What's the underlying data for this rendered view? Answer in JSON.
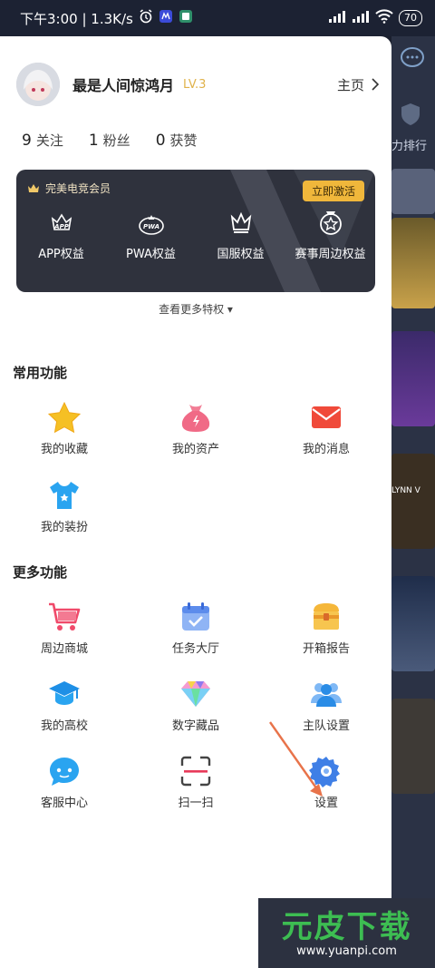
{
  "status_bar": {
    "left_text": "下午3:00 | 1.3K/s",
    "battery": "70"
  },
  "profile": {
    "username": "最是人间惊鸿月",
    "level": "LV.3",
    "homepage_label": "主页"
  },
  "stats": [
    {
      "value": "9",
      "label": "关注"
    },
    {
      "value": "1",
      "label": "粉丝"
    },
    {
      "value": "0",
      "label": "获赞"
    }
  ],
  "vip": {
    "title": "完美电竞会员",
    "activate_label": "立即激活",
    "items": [
      {
        "label": "APP权益",
        "icon": "app-crown-icon"
      },
      {
        "label": "PWA权益",
        "icon": "pwa-crown-icon"
      },
      {
        "label": "国服权益",
        "icon": "crown-icon"
      },
      {
        "label": "赛事周边权益",
        "icon": "medal-icon"
      }
    ]
  },
  "more_privileges": "查看更多特权 ▾",
  "common_functions": {
    "title": "常用功能",
    "items": [
      {
        "label": "我的收藏",
        "icon": "star-icon"
      },
      {
        "label": "我的资产",
        "icon": "money-bag-icon"
      },
      {
        "label": "我的消息",
        "icon": "mail-icon"
      },
      {
        "label": "我的装扮",
        "icon": "tshirt-icon"
      }
    ]
  },
  "more_functions": {
    "title": "更多功能",
    "items": [
      {
        "label": "周边商城",
        "icon": "shopping-cart-icon"
      },
      {
        "label": "任务大厅",
        "icon": "calendar-icon"
      },
      {
        "label": "开箱报告",
        "icon": "treasure-chest-icon"
      },
      {
        "label": "我的高校",
        "icon": "graduation-cap-icon"
      },
      {
        "label": "数字藏品",
        "icon": "diamond-icon"
      },
      {
        "label": "主队设置",
        "icon": "team-icon"
      },
      {
        "label": "客服中心",
        "icon": "chat-bubble-icon"
      },
      {
        "label": "扫一扫",
        "icon": "scan-icon"
      },
      {
        "label": "设置",
        "icon": "gear-icon"
      }
    ]
  },
  "background_page": {
    "partial_label": "力排行",
    "card_label": "LYNN V"
  },
  "watermark": {
    "logo": "元皮下载",
    "url": "www.yuanpi.com"
  },
  "colors": {
    "vip_bg": "#2f323d",
    "activate": "#f0b73b",
    "level": "#e0b24a",
    "arrow": "#e8734a"
  }
}
